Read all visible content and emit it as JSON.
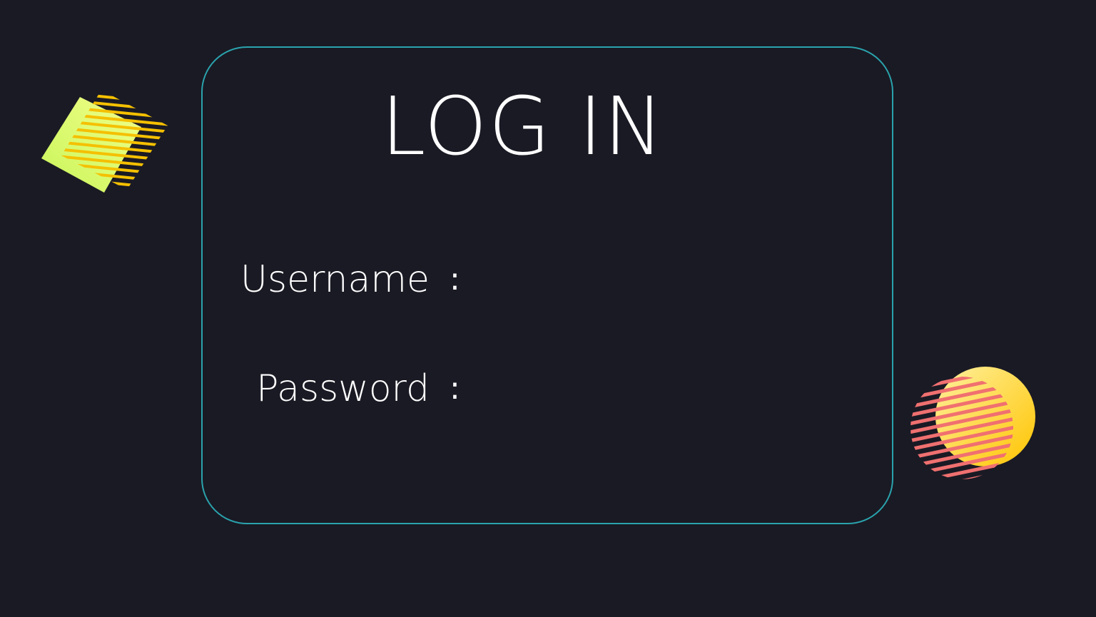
{
  "login": {
    "title": "LOG IN",
    "username_label": "Username",
    "password_label": "Password",
    "separator": ":",
    "username_value": "",
    "password_value": ""
  },
  "theme": {
    "background": "#1a1a24",
    "card_border": "#2aa3ad",
    "text": "#ffffff",
    "deco_diamond_fill": "#d6f56a",
    "deco_diamond_stripes": "#f5c000",
    "deco_circle_fill": "#ffcc00",
    "deco_circle_stripes": "#f07070"
  }
}
